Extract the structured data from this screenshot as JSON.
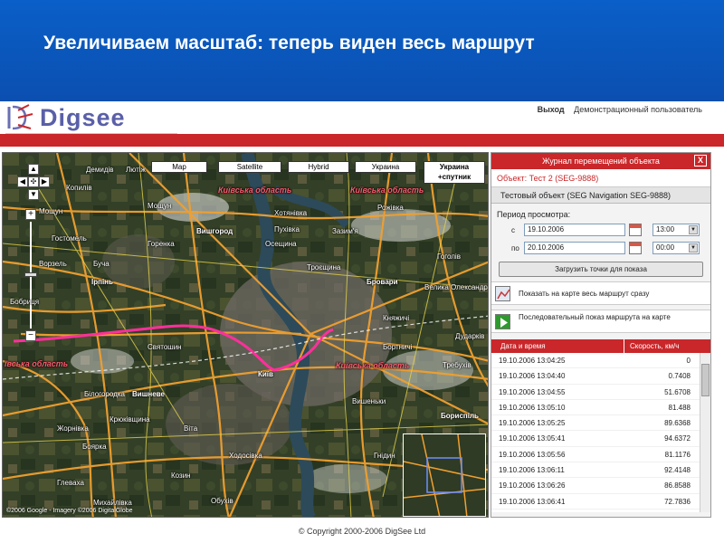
{
  "slide": {
    "title": "Увеличиваем масштаб: теперь виден весь маршрут"
  },
  "header": {
    "logo_text": "Digsee",
    "exit_label": "Выход",
    "user_label": "Демонстрационный пользователь"
  },
  "map": {
    "types": [
      "Map",
      "Satellite",
      "Hybrid",
      "Украина"
    ],
    "active_type": "Украина +спутник",
    "labels": {
      "kyiv_oblast_top_left": "Київська область",
      "kyiv_oblast_top_right": "Київська область",
      "kyiv_oblast_left": "ївська область",
      "kyiv_oblast_right": "Київська область",
      "vyshhorod": "Вишгород",
      "brovary": "Бровари",
      "boryspil": "Бориспіль",
      "kyiv": "Київ",
      "irpin": "Ірпінь",
      "hostomel": "Гостомель",
      "vyshneve": "Вишневе",
      "vorzel": "Ворзель",
      "bucha": "Буча",
      "bilhorodka": "Білогородка",
      "vita": "Віта",
      "boyarka": "Боярка",
      "khotianivka": "Хотянівка",
      "mostyshche": "Мощун",
      "hlevakha": "Глеваха",
      "kniazhychi": "Княжичі",
      "hnidyn": "Гнідин",
      "vyshenky": "Вишеньки",
      "trebukhiv": "Требухів",
      "dudarkiv": "Дударків",
      "zazymia": "Зазим'я",
      "pukhivka": "Пухівка",
      "hoholiv": "Гоголів",
      "rozhivka": "Рожівка",
      "ivankovychi": "Іванковичі",
      "velyka_oleksandrivka": "Велика Олександрівка",
      "kozyn": "Козин",
      "khodosivka": "Ходосівка",
      "bortnychi": "Бортничі",
      "kriukivshchyna": "Крюківщина",
      "troieshchyna": "Троєщина",
      "obukhiv_road": "Обухів",
      "svyatoshyn": "Святошин",
      "moshchun": "Мощун",
      "bobrytsia": "Бобриця",
      "zhornivka": "Жорнівка",
      "horenka": "Горенка",
      "demydiv": "Демидів",
      "liutizh": "Лютіж",
      "osescina": "Осещина",
      "vyshneve2": "Вишневе",
      "mykhailivka": "Михайлівка",
      "kopyliv": "Копилів"
    },
    "footer": "©2006 Google - Imagery ©2006 DigitalGlobe"
  },
  "panel": {
    "title": "Журнал перемещений объекта",
    "close_label": "X",
    "object_title": "Объект: Тест 2 (SEG-9888)",
    "object_selected": "Тестовый объект (SEG Navigation SEG-9888)",
    "period_label": "Период просмотра:",
    "from_label": "с",
    "from_date": "19.10.2006",
    "from_time": "13:00",
    "to_label": "по",
    "to_date": "20.10.2006",
    "to_time": "00:00",
    "load_button": "Загрузить точки для показа",
    "show_route_text": "Показать на карте весь маршрут сразу",
    "sequential_text": "Последовательный показ маршрута на карте",
    "table_headers": {
      "date": "Дата и время",
      "speed": "Скорость, км/ч"
    },
    "rows": [
      {
        "date": "19.10.2006 13:04:25",
        "speed": "0"
      },
      {
        "date": "19.10.2006 13:04:40",
        "speed": "0.7408"
      },
      {
        "date": "19.10.2006 13:04:55",
        "speed": "51.6708"
      },
      {
        "date": "19.10.2006 13:05:10",
        "speed": "81.488"
      },
      {
        "date": "19.10.2006 13:05:25",
        "speed": "89.6368"
      },
      {
        "date": "19.10.2006 13:05:41",
        "speed": "94.6372"
      },
      {
        "date": "19.10.2006 13:05:56",
        "speed": "81.1176"
      },
      {
        "date": "19.10.2006 13:06:11",
        "speed": "92.4148"
      },
      {
        "date": "19.10.2006 13:06:26",
        "speed": "86.8588"
      },
      {
        "date": "19.10.2006 13:06:41",
        "speed": "72.7836"
      }
    ]
  },
  "footer": {
    "copyright": "© Copyright 2000-2006 DigSee Ltd"
  },
  "colors": {
    "brand_red": "#c9272a",
    "slide_blue": "#0b55b8",
    "route_pink": "#ff2f9a",
    "road_orange": "#f0a030"
  }
}
